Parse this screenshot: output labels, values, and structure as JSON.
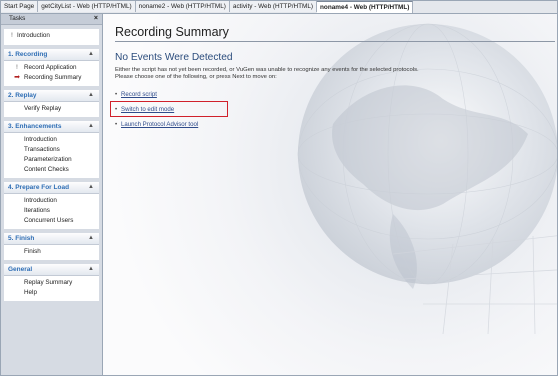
{
  "tabs": [
    {
      "label": "Start Page"
    },
    {
      "label": "getCityList - Web (HTTP/HTML)"
    },
    {
      "label": "noname2 - Web (HTTP/HTML)"
    },
    {
      "label": "activity - Web (HTTP/HTML)"
    },
    {
      "label": "noname4 - Web (HTTP/HTML)",
      "active": true
    }
  ],
  "pane": {
    "title": "Tasks",
    "close": "×",
    "intro": "Introduction",
    "groups": [
      {
        "title": "1. Recording",
        "items": [
          "Record Application",
          "Recording Summary"
        ]
      },
      {
        "title": "2. Replay",
        "items": [
          "Verify Replay"
        ]
      },
      {
        "title": "3. Enhancements",
        "items": [
          "Introduction",
          "Transactions",
          "Parameterization",
          "Content Checks"
        ]
      },
      {
        "title": "4. Prepare For Load",
        "items": [
          "Introduction",
          "Iterations",
          "Concurrent Users"
        ]
      },
      {
        "title": "5. Finish",
        "items": [
          "Finish"
        ]
      },
      {
        "title": "General",
        "items": [
          "Replay Summary",
          "Help"
        ]
      }
    ]
  },
  "main": {
    "title": "Recording Summary",
    "subtitle": "No Events Were Detected",
    "description_line1": "Either the script has not yet been recorded, or VuGen was unable to recognize any events for the selected protocols.",
    "description_line2": "Please choose one of the following, or press Next to move on:",
    "options": [
      "Record script",
      "Switch to edit mode",
      "Launch Protocol Advisor tool"
    ]
  },
  "colors": {
    "accent": "#2f6eb5",
    "highlight": "#d0202b",
    "link": "#2f4b8a"
  }
}
